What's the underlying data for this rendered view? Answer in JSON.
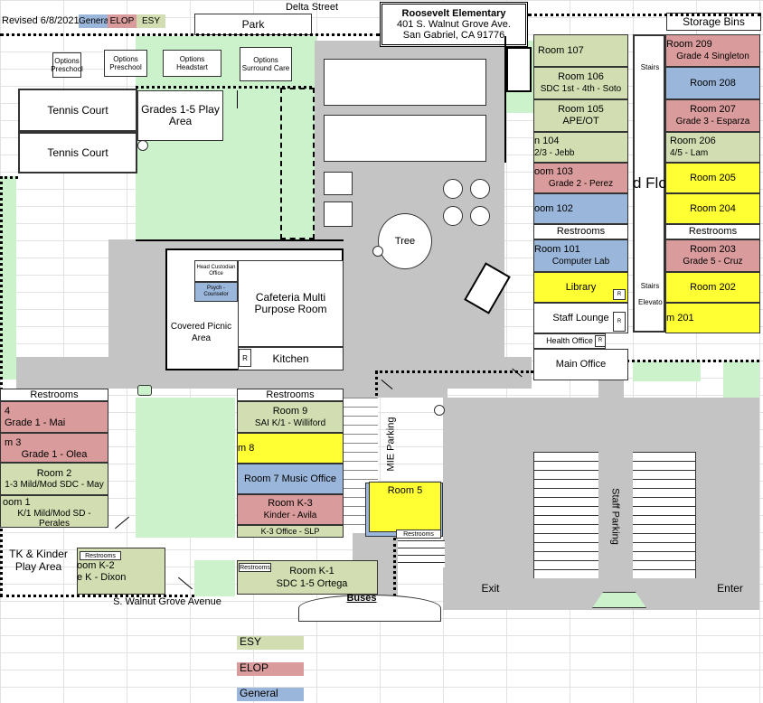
{
  "header": {
    "revised": "Revised 6/8/2021",
    "key_general": "Genera",
    "key_elop": "ELOP",
    "key_esy": "ESY",
    "street_top": "Delta Street",
    "street_park": "Park",
    "school_name": "Roosevelt Elementary",
    "address_1": "401 S. Walnut Grove Ave.",
    "address_2": "San Gabriel, CA 91776",
    "storage": "Storage Bins"
  },
  "portables": [
    "Options Preschool",
    "Options Preschool",
    "Options Headstart",
    "Options Surround Care"
  ],
  "courts": [
    "Tennis Court",
    "Tennis Court"
  ],
  "play_area": "Grades 1-5 Play Area",
  "tree": "Tree",
  "cafeteria": {
    "custodian": "Head Custodian Office",
    "psych": "Psych - Counselor",
    "main": "Cafeteria Multi Purpose Room",
    "picnic": "Covered Picnic Area",
    "kitchen": "Kitchen",
    "r": "R"
  },
  "right_col1": {
    "r107": "Room 107",
    "r106a": "Room 106",
    "r106b": "SDC 1st - 4th - Soto",
    "r105a": "Room 105",
    "r105b": "APE/OT",
    "r104a": "n 104",
    "r104b": "2/3 - Jebb",
    "r103a": "oom 103",
    "r103b": "Grade 2 - Perez",
    "r102": "oom  102",
    "restrooms": "Restrooms",
    "r101a": "Room 101",
    "r101b": "Computer Lab",
    "library": "Library",
    "staff_lounge": "Staff Lounge",
    "health": "Health Office",
    "main_office": "Main Office",
    "r": "R"
  },
  "second_floor_label": "d Flo",
  "stairs": [
    "Stairs",
    "Stairs"
  ],
  "elevator": "Elevato",
  "right_col2": {
    "r209a": "Room 209",
    "r209b": "Grade 4 Singleton",
    "r208": "Room 208",
    "r207a": "Room 207",
    "r207b": "Grade 3 - Esparza",
    "r206a": "Room 206",
    "r206b": "4/5 - Lam",
    "r205": "Room 205",
    "r204": "Room 204",
    "restrooms": "Restrooms",
    "r203a": "Room 203",
    "r203b": "Grade 5 - Cruz",
    "r202": "Room 202",
    "r201": "m 201"
  },
  "left_wing": {
    "restrooms": "Restrooms",
    "r4a": "4",
    "r4b": "Grade 1 - Mai",
    "r3a": "m 3",
    "r3b": "Grade 1 - Olea",
    "r2a": "Room 2",
    "r2b": "1-3 Mild/Mod SDC - May",
    "r1a": "oom 1",
    "r1b": "K/1 Mild/Mod SD - Perales",
    "tk": "TK & Kinder Play Area",
    "k2r": "Restrooms",
    "k2a": "oom K-2",
    "k2b": "e K - Dixon"
  },
  "mid_wing": {
    "restrooms": "Restrooms",
    "r9a": "Room 9",
    "r9b": "SAI K/1 - Williford",
    "r8": "m 8",
    "r7": "Room 7 Music Office",
    "k3a": "Room K-3",
    "k3b": "Kinder - Avila",
    "k3office": "K-3 Office - SLP",
    "k1r": "Restrooms",
    "k1a": "Room K-1",
    "k1b": "SDC 1-5 Ortega"
  },
  "room5": "Room 5",
  "room5_restrooms": "Restrooms",
  "mie_parking": "MIE Parking",
  "staff_parking": "Staff Parking",
  "exit": "Exit",
  "enter": "Enter",
  "buses": "Buses",
  "street_bottom": "S. Walnut Grove Avenue",
  "legend": {
    "esy": "ESY",
    "elop": "ELOP",
    "general": "General"
  },
  "colors": {
    "esy": "#d2deb1",
    "elop": "#d99b9b",
    "general": "#9ab6da",
    "room_yellow": "#ffff33",
    "grass": "#ccf2cc",
    "pavement": "#c4c4c4"
  }
}
